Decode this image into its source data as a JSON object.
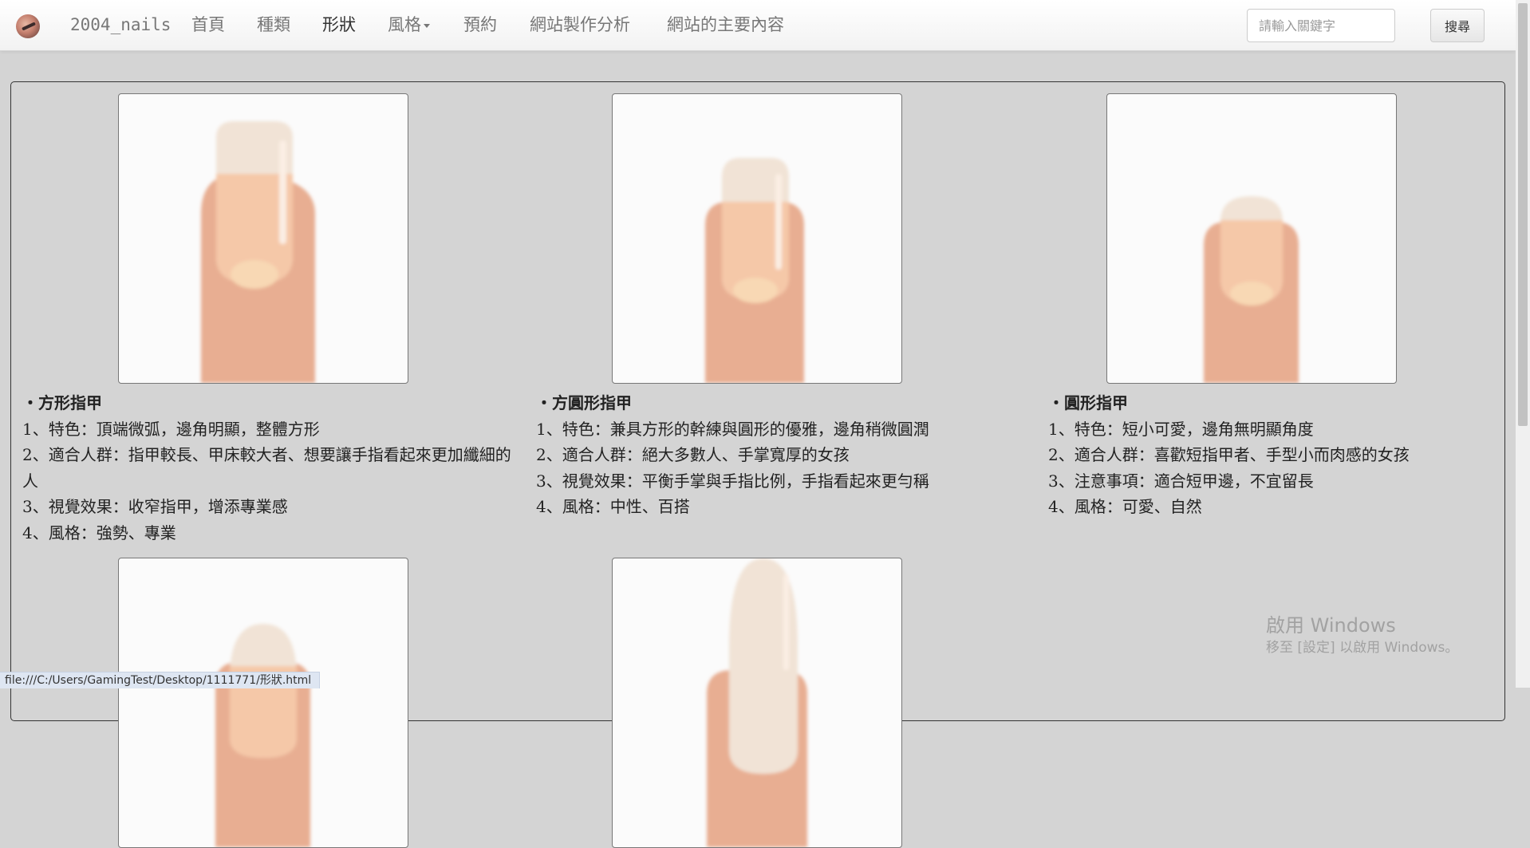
{
  "nav": {
    "brand": "2004_nails",
    "items": [
      {
        "label": "首頁"
      },
      {
        "label": "種類"
      },
      {
        "label": "形狀"
      },
      {
        "label": "風格"
      },
      {
        "label": "預約"
      },
      {
        "label": "網站製作分析"
      },
      {
        "label": "網站的主要內容"
      }
    ],
    "search_placeholder": "請輸入關鍵字",
    "search_button": "搜尋"
  },
  "shapes": [
    {
      "title": "・方形指甲",
      "lines": [
        "1、特色：頂端微弧，邊角明顯，整體方形",
        "2、適合人群：指甲較長、甲床較大者、想要讓手指看起來更加纖細的人",
        "3、視覺效果：收窄指甲，增添專業感",
        "4、風格：強勢、專業"
      ]
    },
    {
      "title": "・方圓形指甲",
      "lines": [
        "1、特色：兼具方形的幹練與圓形的優雅，邊角稍微圓潤",
        "2、適合人群：絕大多數人、手掌寬厚的女孩",
        "3、視覺效果：平衡手掌與手指比例，手指看起來更勻稱",
        "4、風格：中性、百搭"
      ]
    },
    {
      "title": "・圓形指甲",
      "lines": [
        "1、特色：短小可愛，邊角無明顯角度",
        "2、適合人群：喜歡短指甲者、手型小而肉感的女孩",
        "3、注意事項：適合短甲邊，不宜留長",
        "4、風格：可愛、自然"
      ]
    }
  ],
  "colors": {
    "finger": "#e8ae92",
    "nail": "#f5c8a8",
    "nail_tip": "#f1e3d6",
    "lunula": "#f8d8b4",
    "highlight": "#fbeee4",
    "background": "#d4d4d4"
  },
  "status_bar": "file:///C:/Users/GamingTest/Desktop/1111771/形狀.html",
  "watermark": {
    "line1": "啟用 Windows",
    "line2": "移至 [設定] 以啟用 Windows。"
  }
}
